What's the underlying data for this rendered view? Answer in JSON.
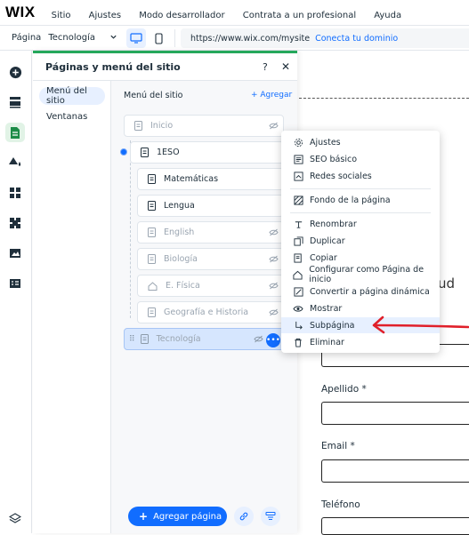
{
  "topbar": {
    "logo": "WIX",
    "menu": [
      "Sitio",
      "Ajustes",
      "Modo desarrollador",
      "Contrata a un profesional",
      "Ayuda"
    ]
  },
  "toolbar": {
    "page_label": "Página",
    "page_value": "Tecnología",
    "url": "https://www.wix.com/mysite",
    "connect_domain": "Conecta tu dominio"
  },
  "panel": {
    "title": "Páginas y menú del sitio",
    "help": "?",
    "close": "✕",
    "subnav": [
      "Menú del sitio",
      "Ventanas"
    ],
    "menu_heading": "Menú del sitio",
    "add_link": "+ Agregar",
    "pages": [
      {
        "label": "Inicio",
        "hidden": true
      },
      {
        "label": "1ESO",
        "hidden": false
      },
      {
        "label": "Matemáticas",
        "hidden": false
      },
      {
        "label": "Lengua",
        "hidden": false
      },
      {
        "label": "English",
        "hidden": true
      },
      {
        "label": "Biología",
        "hidden": true
      },
      {
        "label": "E. Física",
        "hidden": true
      },
      {
        "label": "Geografía e Historia",
        "hidden": true
      },
      {
        "label": "Tecnología",
        "hidden": true,
        "selected": true
      }
    ],
    "add_page_button": "Agregar página"
  },
  "context_menu": {
    "items": [
      "Ajustes",
      "SEO básico",
      "Redes sociales",
      "Fondo de la página",
      "Renombrar",
      "Duplicar",
      "Copiar",
      "Configurar como Página de inicio",
      "Convertir a página dinámica",
      "Mostrar",
      "Subpágina",
      "Eliminar"
    ],
    "highlighted": "Subpágina"
  },
  "canvas": {
    "partial_heading": "ud",
    "fields": [
      "Apellido *",
      "Email *",
      "Teléfono"
    ]
  },
  "colors": {
    "accent": "#116dff",
    "green": "#25a85b",
    "arrow": "#e0202a"
  }
}
